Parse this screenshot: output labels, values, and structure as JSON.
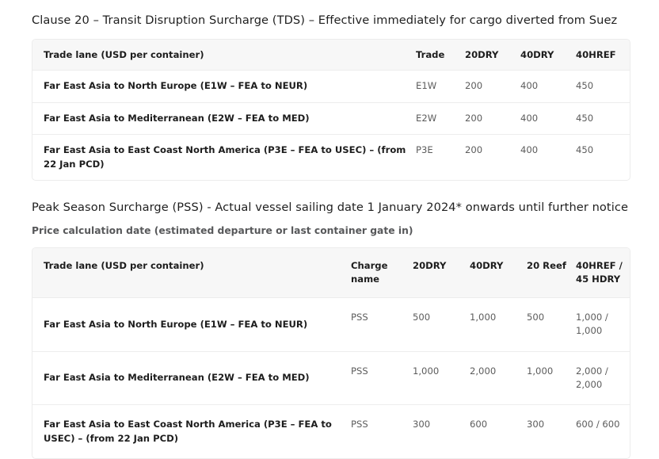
{
  "sections": [
    {
      "heading": "Clause 20 – Transit Disruption Surcharge (TDS) – Effective immediately for cargo diverted from Suez",
      "table": {
        "headers": {
          "lane": "Trade lane (USD per container)",
          "col_a": "Trade",
          "col_b": "20DRY",
          "col_c": "40DRY",
          "col_d": "40HREF"
        },
        "rows": [
          {
            "lane": "Far East Asia to North Europe (E1W – FEA to NEUR)",
            "col_a": "E1W",
            "col_b": "200",
            "col_c": "400",
            "col_d": "450"
          },
          {
            "lane": "Far East Asia to Mediterranean (E2W – FEA to MED)",
            "col_a": "E2W",
            "col_b": "200",
            "col_c": "400",
            "col_d": "450"
          },
          {
            "lane": "Far East Asia to East Coast North America (P3E – FEA to USEC) – (from 22 Jan PCD)",
            "col_a": "P3E",
            "col_b": "200",
            "col_c": "400",
            "col_d": "450"
          }
        ]
      }
    },
    {
      "heading": "Peak Season Surcharge (PSS) - Actual vessel sailing date 1 January 2024* onwards until further notice",
      "subheading": "Price calculation date (estimated departure or last container gate in)",
      "table": {
        "headers": {
          "lane": "Trade lane (USD per container)",
          "col_a": "Charge name",
          "col_b": "20DRY",
          "col_c": "40DRY",
          "col_d": "20 Reef",
          "col_e": "40HREF / 45 HDRY"
        },
        "rows": [
          {
            "lane": "Far East Asia to North Europe (E1W – FEA to NEUR)",
            "col_a": "PSS",
            "col_b": "500",
            "col_c": "1,000",
            "col_d": "500",
            "col_e": "1,000 / 1,000"
          },
          {
            "lane": "Far East Asia to Mediterranean (E2W – FEA to MED)",
            "col_a": "PSS",
            "col_b": "1,000",
            "col_c": "2,000",
            "col_d": "1,000",
            "col_e": "2,000 / 2,000"
          },
          {
            "lane": "Far East Asia to East Coast North America (P3E – FEA to USEC) – (from 22 Jan PCD)",
            "col_a": "PSS",
            "col_b": "300",
            "col_c": "600",
            "col_d": "300",
            "col_e": "600 / 600"
          }
        ]
      }
    }
  ]
}
